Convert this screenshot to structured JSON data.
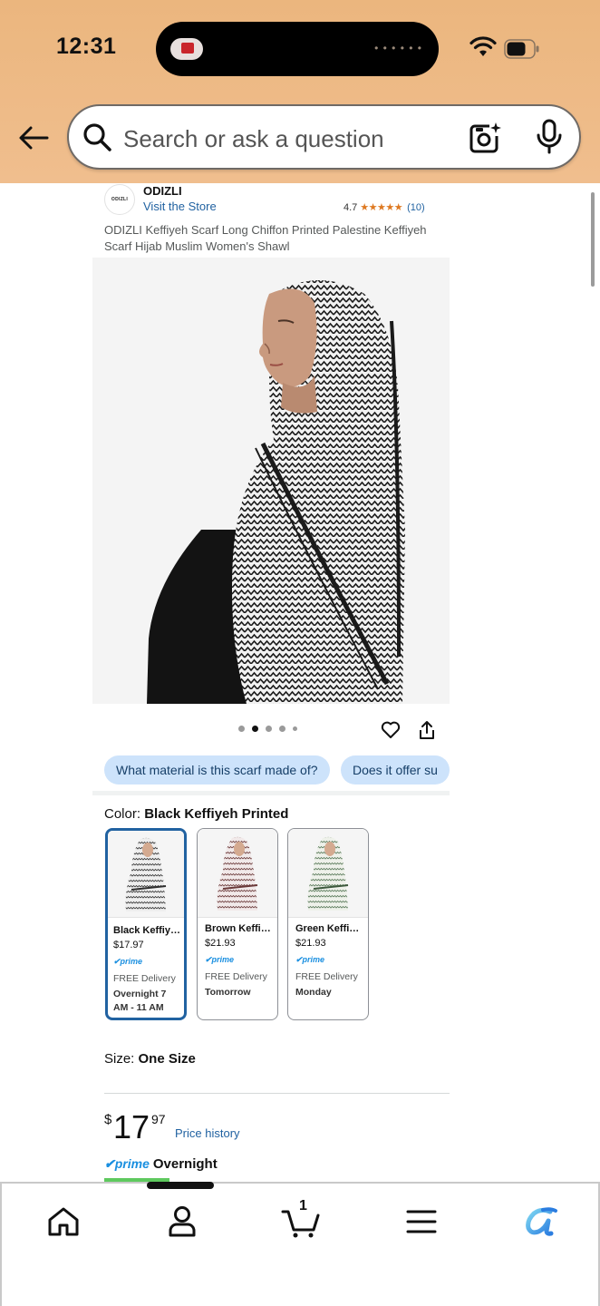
{
  "status_bar": {
    "time": "12:31"
  },
  "search": {
    "placeholder": "Search or ask a question"
  },
  "store": {
    "logo_text": "ODIZLI",
    "brand": "ODIZLI",
    "visit_link": "Visit the Store",
    "rating_value": "4.7",
    "stars": "★★★★★",
    "rating_count": "(10)"
  },
  "product": {
    "title": "ODIZLI Keffiyeh Scarf Long Chiffon Printed Palestine Keffiyeh Scarf Hijab Muslim Women's Shawl",
    "image_count": 5,
    "active_image_index": 1
  },
  "questions": [
    "What material is this scarf made of?",
    "Does it offer su"
  ],
  "color": {
    "label": "Color: ",
    "selected": "Black Keffiyeh Printed",
    "options": [
      {
        "name": "Black Keffiy…",
        "price": "$17.97",
        "prime": "✔prime",
        "delivery": "FREE Delivery",
        "when": "Overnight 7 AM - 11 AM",
        "accent": "#2f2f2f"
      },
      {
        "name": "Brown Keffi…",
        "price": "$21.93",
        "prime": "✔prime",
        "delivery": "FREE Delivery",
        "when": "Tomorrow",
        "accent": "#6b3a3a"
      },
      {
        "name": "Green Keffi…",
        "price": "$21.93",
        "prime": "✔prime",
        "delivery": "FREE Delivery",
        "when": "Monday",
        "accent": "#3d5a3d"
      }
    ]
  },
  "size": {
    "label": "Size: ",
    "value": "One Size"
  },
  "price": {
    "symbol": "$",
    "whole": "17",
    "fraction": "97",
    "history_link": "Price history"
  },
  "shipping": {
    "prime_logo": "✔prime",
    "speed": "Overnight"
  },
  "nav": {
    "cart_count": "1"
  },
  "colors": {
    "header_bg": "#ebb67e",
    "link": "#2162a1",
    "chip_bg": "#cde3fb",
    "star": "#de7921",
    "prime": "#1a8fe0"
  }
}
